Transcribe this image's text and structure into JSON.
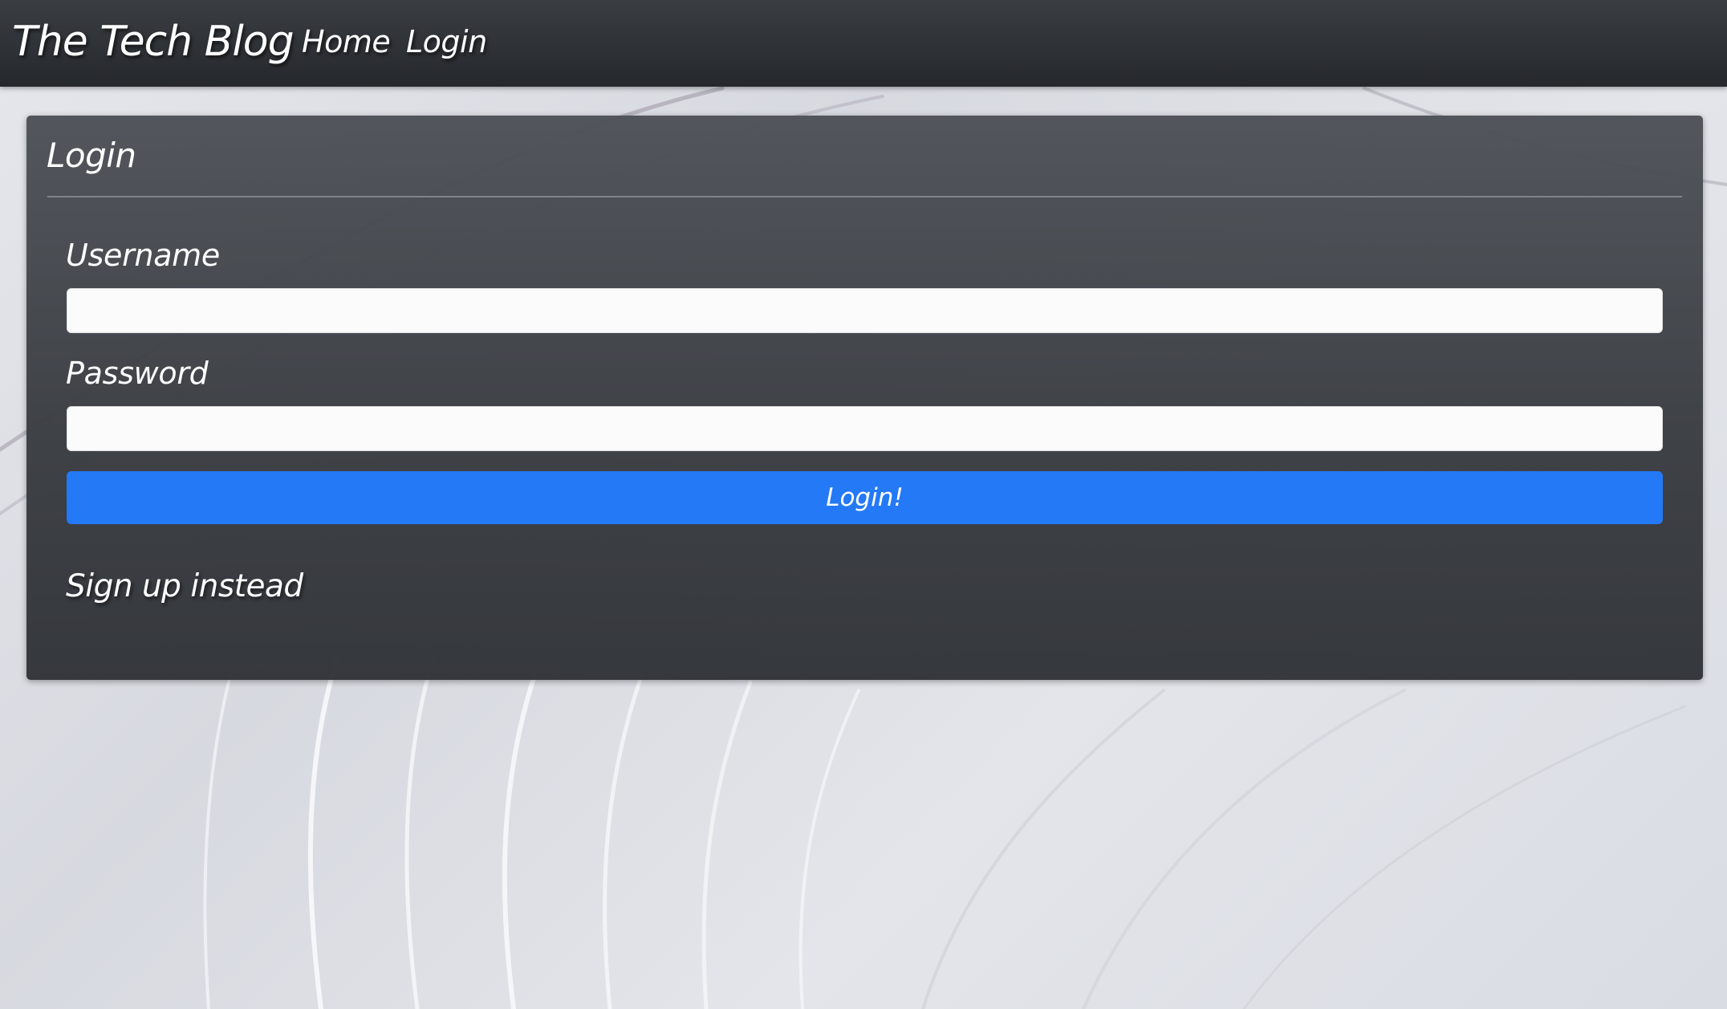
{
  "navbar": {
    "brand": "The Tech Blog",
    "links": [
      {
        "label": "Home"
      },
      {
        "label": "Login"
      }
    ]
  },
  "login_card": {
    "title": "Login",
    "username": {
      "label": "Username",
      "value": "",
      "placeholder": ""
    },
    "password": {
      "label": "Password",
      "value": "",
      "placeholder": ""
    },
    "submit_label": "Login!",
    "signup_link": "Sign up instead"
  },
  "colors": {
    "navbar_bg": "#2b2e33",
    "card_bg": "#45484d",
    "button_primary": "#2479f7",
    "text": "#ffffff",
    "page_bg": "#dfe1e6"
  }
}
